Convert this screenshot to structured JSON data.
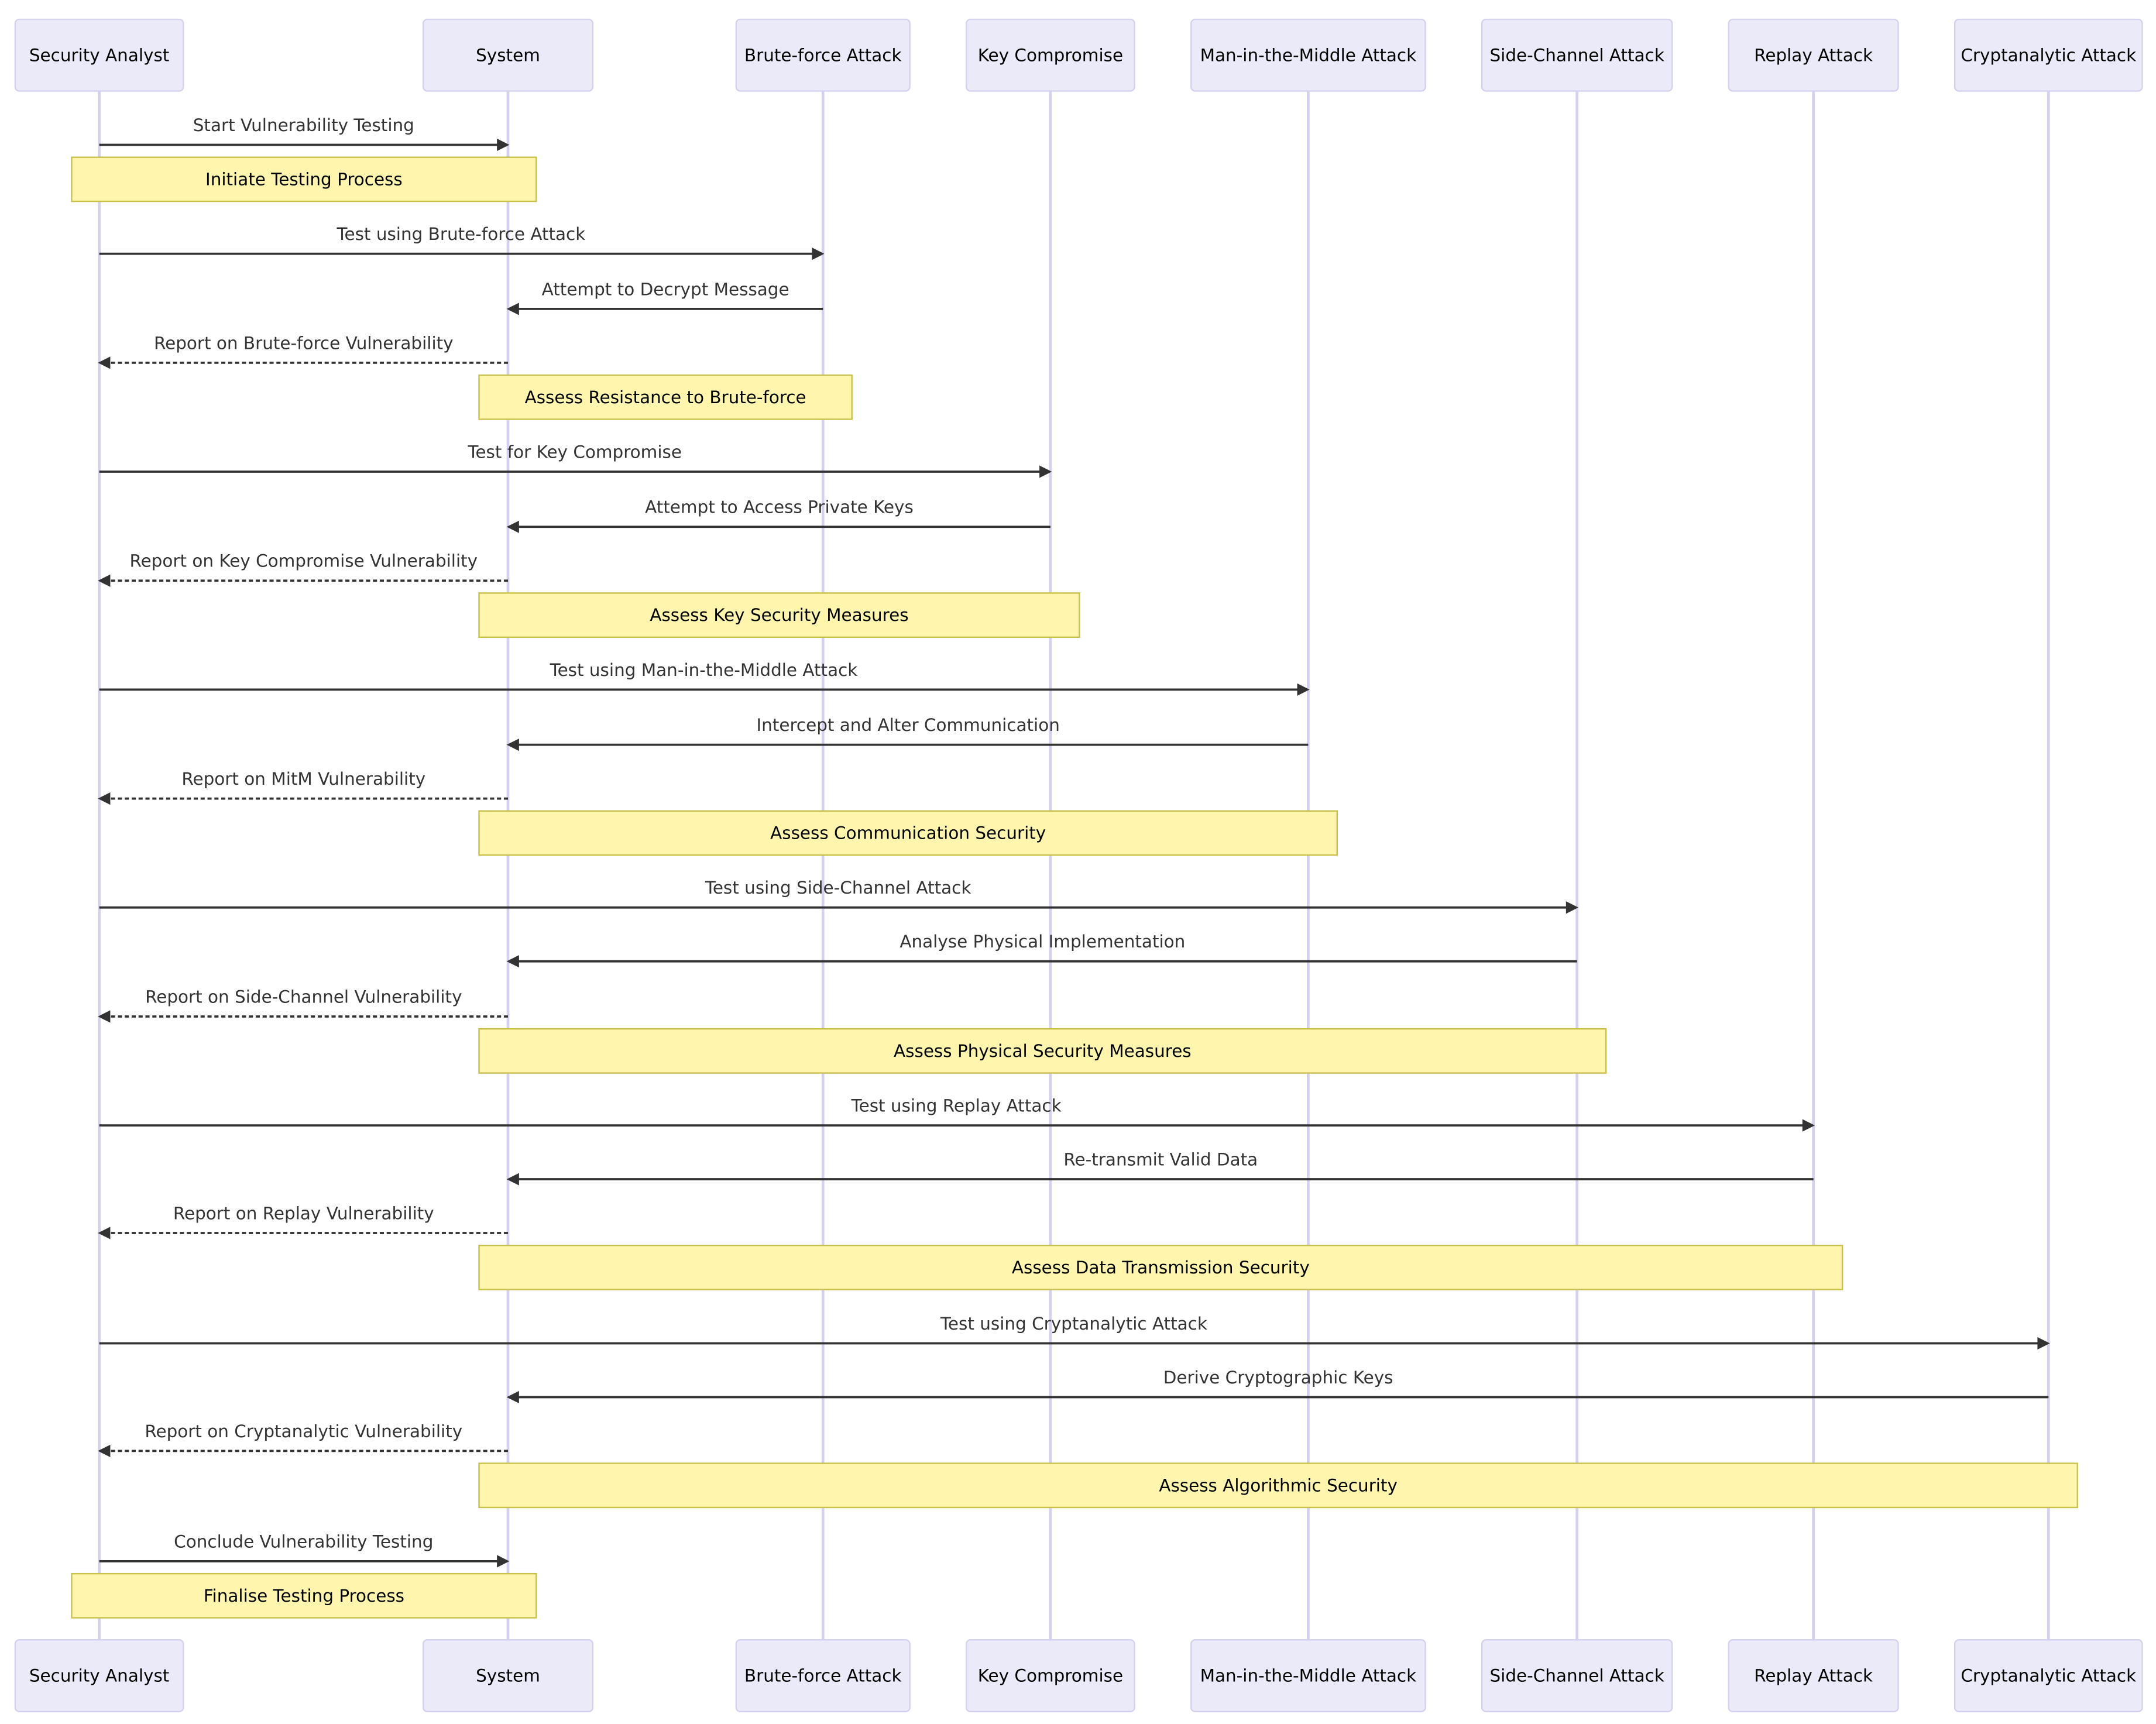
{
  "diagram": {
    "type": "sequence",
    "colors": {
      "actor_fill": "#eaeaf9",
      "actor_border": "#d4d0ef",
      "lifeline": "#d4d0ef",
      "message": "#333333",
      "note_fill": "#fff5ad",
      "note_border": "#c8c04a"
    },
    "actors": [
      {
        "id": "analyst",
        "label": "Security Analyst"
      },
      {
        "id": "system",
        "label": "System"
      },
      {
        "id": "brute",
        "label": "Brute-force Attack"
      },
      {
        "id": "key",
        "label": "Key Compromise"
      },
      {
        "id": "mitm",
        "label": "Man-in-the-Middle Attack"
      },
      {
        "id": "side",
        "label": "Side-Channel Attack"
      },
      {
        "id": "replay",
        "label": "Replay Attack"
      },
      {
        "id": "crypt",
        "label": "Cryptanalytic Attack"
      }
    ],
    "steps": [
      {
        "kind": "message",
        "from": "analyst",
        "to": "system",
        "style": "solid",
        "label": "Start Vulnerability Testing"
      },
      {
        "kind": "note",
        "over": [
          "analyst",
          "system"
        ],
        "label": "Initiate Testing Process"
      },
      {
        "kind": "message",
        "from": "analyst",
        "to": "brute",
        "style": "solid",
        "label": "Test using Brute-force Attack"
      },
      {
        "kind": "message",
        "from": "brute",
        "to": "system",
        "style": "solid",
        "label": "Attempt to Decrypt Message"
      },
      {
        "kind": "message",
        "from": "system",
        "to": "analyst",
        "style": "dashed",
        "label": "Report on Brute-force Vulnerability"
      },
      {
        "kind": "note",
        "over": [
          "system",
          "brute"
        ],
        "label": "Assess Resistance to Brute-force"
      },
      {
        "kind": "message",
        "from": "analyst",
        "to": "key",
        "style": "solid",
        "label": "Test for Key Compromise"
      },
      {
        "kind": "message",
        "from": "key",
        "to": "system",
        "style": "solid",
        "label": "Attempt to Access Private Keys"
      },
      {
        "kind": "message",
        "from": "system",
        "to": "analyst",
        "style": "dashed",
        "label": "Report on Key Compromise Vulnerability"
      },
      {
        "kind": "note",
        "over": [
          "system",
          "key"
        ],
        "label": "Assess Key Security Measures"
      },
      {
        "kind": "message",
        "from": "analyst",
        "to": "mitm",
        "style": "solid",
        "label": "Test using Man-in-the-Middle Attack"
      },
      {
        "kind": "message",
        "from": "mitm",
        "to": "system",
        "style": "solid",
        "label": "Intercept and Alter Communication"
      },
      {
        "kind": "message",
        "from": "system",
        "to": "analyst",
        "style": "dashed",
        "label": "Report on MitM Vulnerability"
      },
      {
        "kind": "note",
        "over": [
          "system",
          "mitm"
        ],
        "label": "Assess Communication Security"
      },
      {
        "kind": "message",
        "from": "analyst",
        "to": "side",
        "style": "solid",
        "label": "Test using Side-Channel Attack"
      },
      {
        "kind": "message",
        "from": "side",
        "to": "system",
        "style": "solid",
        "label": "Analyse Physical Implementation"
      },
      {
        "kind": "message",
        "from": "system",
        "to": "analyst",
        "style": "dashed",
        "label": "Report on Side-Channel Vulnerability"
      },
      {
        "kind": "note",
        "over": [
          "system",
          "side"
        ],
        "label": "Assess Physical Security Measures"
      },
      {
        "kind": "message",
        "from": "analyst",
        "to": "replay",
        "style": "solid",
        "label": "Test using Replay Attack"
      },
      {
        "kind": "message",
        "from": "replay",
        "to": "system",
        "style": "solid",
        "label": "Re-transmit Valid Data"
      },
      {
        "kind": "message",
        "from": "system",
        "to": "analyst",
        "style": "dashed",
        "label": "Report on Replay Vulnerability"
      },
      {
        "kind": "note",
        "over": [
          "system",
          "replay"
        ],
        "label": "Assess Data Transmission Security"
      },
      {
        "kind": "message",
        "from": "analyst",
        "to": "crypt",
        "style": "solid",
        "label": "Test using Cryptanalytic Attack"
      },
      {
        "kind": "message",
        "from": "crypt",
        "to": "system",
        "style": "solid",
        "label": "Derive Cryptographic Keys"
      },
      {
        "kind": "message",
        "from": "system",
        "to": "analyst",
        "style": "dashed",
        "label": "Report on Cryptanalytic Vulnerability"
      },
      {
        "kind": "note",
        "over": [
          "system",
          "crypt"
        ],
        "label": "Assess Algorithmic Security"
      },
      {
        "kind": "message",
        "from": "analyst",
        "to": "system",
        "style": "solid",
        "label": "Conclude Vulnerability Testing"
      },
      {
        "kind": "note",
        "over": [
          "analyst",
          "system"
        ],
        "label": "Finalise Testing Process"
      }
    ]
  }
}
